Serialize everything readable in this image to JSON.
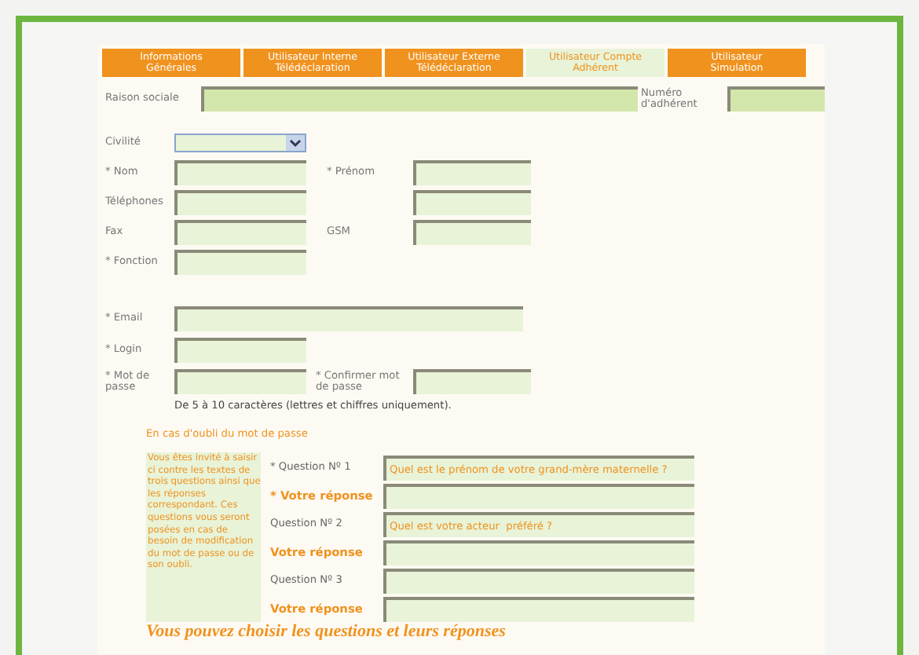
{
  "tabs": [
    {
      "label": "Informations Générales",
      "selected": false
    },
    {
      "label": "Utilisateur Interne Télédéclaration",
      "selected": false
    },
    {
      "label": "Utilisateur Externe Télédéclaration",
      "selected": false
    },
    {
      "label": "Utilisateur Compte Adhérent",
      "selected": true
    },
    {
      "label": "Utilisateur Simulation",
      "selected": false
    }
  ],
  "header": {
    "raison_label": "Raison sociale",
    "numero_label": "Numéro d'adhérent"
  },
  "civilite": {
    "label": "Civilité"
  },
  "rows": [
    {
      "left": "* Nom",
      "right": {
        "label": "* Prénom"
      }
    },
    {
      "left": "Téléphones",
      "right": {}
    },
    {
      "left": "Fax",
      "right": {
        "label": "GSM"
      }
    },
    {
      "left": "* Fonction"
    }
  ],
  "email": {
    "label": "* Email"
  },
  "login": {
    "label": "*  Login"
  },
  "password": {
    "label": "* Mot de passe",
    "confirm_label": "* Confirmer mot de passe",
    "hint": "De 5 à 10  caractères (lettres et chiffres uniquement)."
  },
  "recovery": {
    "title": "En cas d'oubli du mot de passe",
    "help": "Vous êtes invité à saisir ci contre les textes de trois questions ainsi que les réponses correspondant. Ces questions vous seront posées en cas de besoin de modification du mot de passe ou de son oubli.",
    "items": [
      {
        "kind": "question",
        "label": "* Question Nº 1",
        "value": "Quel est le prénom de votre grand-mère maternelle ?"
      },
      {
        "kind": "answer",
        "label": "* Votre réponse",
        "value": ""
      },
      {
        "kind": "question",
        "label": "Question Nº 2",
        "value": "Quel est votre acteur  préféré ?"
      },
      {
        "kind": "answer",
        "label": "Votre réponse",
        "value": ""
      },
      {
        "kind": "question",
        "label": "Question Nº 3",
        "value": ""
      },
      {
        "kind": "answer",
        "label": "Votre réponse",
        "value": ""
      }
    ],
    "footer": "Vous pouvez choisir les questions et leurs réponses"
  }
}
